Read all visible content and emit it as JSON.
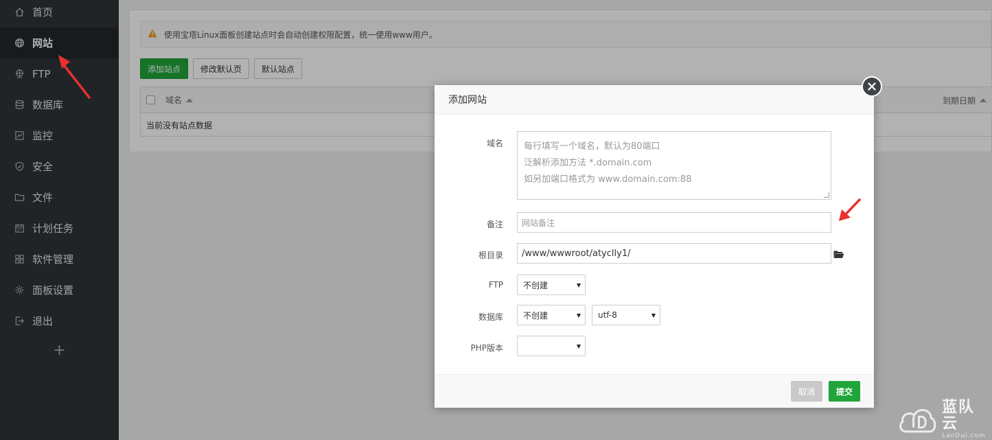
{
  "sidebar": {
    "items": [
      {
        "label": "首页",
        "icon": "home-icon"
      },
      {
        "label": "网站",
        "icon": "globe-icon",
        "active": true
      },
      {
        "label": "FTP",
        "icon": "ftp-icon"
      },
      {
        "label": "数据库",
        "icon": "database-icon"
      },
      {
        "label": "监控",
        "icon": "monitor-icon"
      },
      {
        "label": "安全",
        "icon": "shield-icon"
      },
      {
        "label": "文件",
        "icon": "folder-icon"
      },
      {
        "label": "计划任务",
        "icon": "calendar-icon"
      },
      {
        "label": "软件管理",
        "icon": "grid-icon"
      },
      {
        "label": "面板设置",
        "icon": "gear-icon"
      },
      {
        "label": "退出",
        "icon": "logout-icon"
      }
    ],
    "add_label": "+"
  },
  "main": {
    "notice": "使用宝塔Linux面板创建站点时会自动创建权限配置，统一使用www用户。",
    "buttons": {
      "add_site": "添加站点",
      "edit_default_page": "修改默认页",
      "default_site": "默认站点"
    },
    "table": {
      "col_domain": "域名",
      "col_expire": "到期日期",
      "empty": "当前没有站点数据"
    }
  },
  "modal": {
    "title": "添加网站",
    "domain_label": "域名",
    "domain_placeholder_lines": [
      "每行填写一个域名，默认为80端口",
      "泛解析添加方法 *.domain.com",
      "如另加端口格式为 www.domain.com:88"
    ],
    "remark_label": "备注",
    "remark_placeholder": "网站备注",
    "root_label": "根目录",
    "root_value": "/www/wwwroot/atyclly1/",
    "ftp_label": "FTP",
    "ftp_value": "不创建",
    "db_label": "数据库",
    "db_value": "不创建",
    "db_charset": "utf-8",
    "php_label": "PHP版本",
    "php_value": "",
    "cancel_label": "取消",
    "submit_label": "提交"
  },
  "watermark": {
    "main": "蓝队云",
    "sub": "LanDui.com"
  },
  "colors": {
    "sidebar_bg": "#2f3438",
    "accent_green": "#20a53a",
    "arrow_red": "#e8312f"
  }
}
